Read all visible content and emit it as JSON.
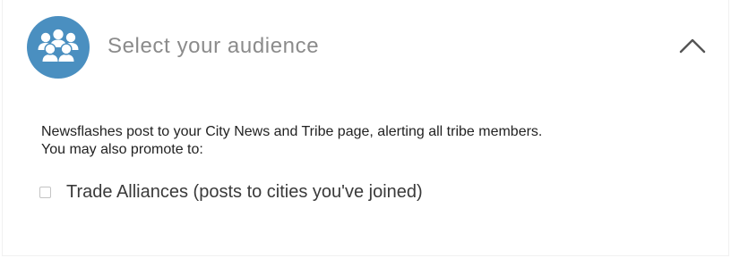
{
  "header": {
    "icon": "group-people-icon",
    "title": "Select your audience",
    "toggle_icon": "chevron-up-icon",
    "accent_color": "#4a8fc0"
  },
  "content": {
    "line1": "Newsflashes post to your City News and Tribe page, alerting all tribe members.",
    "line2": "You may also promote to:"
  },
  "options": [
    {
      "label": "Trade Alliances (posts to cities you've joined)",
      "checked": false
    }
  ]
}
